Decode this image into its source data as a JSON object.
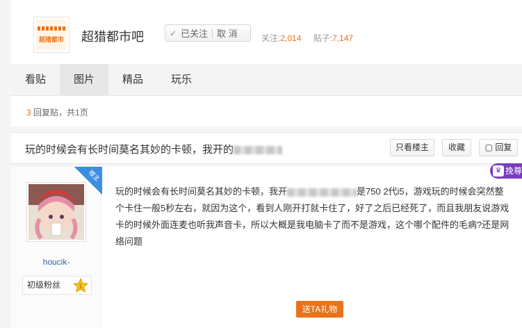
{
  "forum": {
    "logo_text": "超猎都市",
    "name": "超猎都市吧",
    "follow_label": "已关注",
    "cancel_label": "取 消",
    "followers_label": "关注:",
    "followers": "2,014",
    "posts_label": "贴子:",
    "posts": "7,147"
  },
  "tabs": [
    "看贴",
    "图片",
    "精品",
    "玩乐"
  ],
  "page_info": {
    "replies": "3",
    "replies_label": " 回复贴，共",
    "pages": "1",
    "pages_label": "页"
  },
  "thread": {
    "title": "玩的时候会有长时间莫名其妙的卡顿，我开的",
    "only_author": "只看楼主",
    "favorite": "收藏",
    "reply": "回复"
  },
  "post": {
    "badge": "楼主",
    "username": "houcik-",
    "level": "初级粉丝",
    "level_num": "1",
    "text_1": "玩的时候会有长时间莫名其妙的卡顿，我开",
    "text_2": "是750 2代i5，游戏玩的时候会突然整个卡住一般5秒左右，就因为这个，看到人刚开打就卡住了，好了之后已经死了，而且我朋友说游戏卡的时候外面连麦也听我声音卡，所以大概是我电脑卡了而不是游戏，这个哪个配件的毛病?还是网络问题",
    "gift": "送TA礼物",
    "vip": "挽尊"
  },
  "colors": {
    "accent": "#e8731a",
    "link": "#2d64b3",
    "vip": "#7b3bbf"
  }
}
